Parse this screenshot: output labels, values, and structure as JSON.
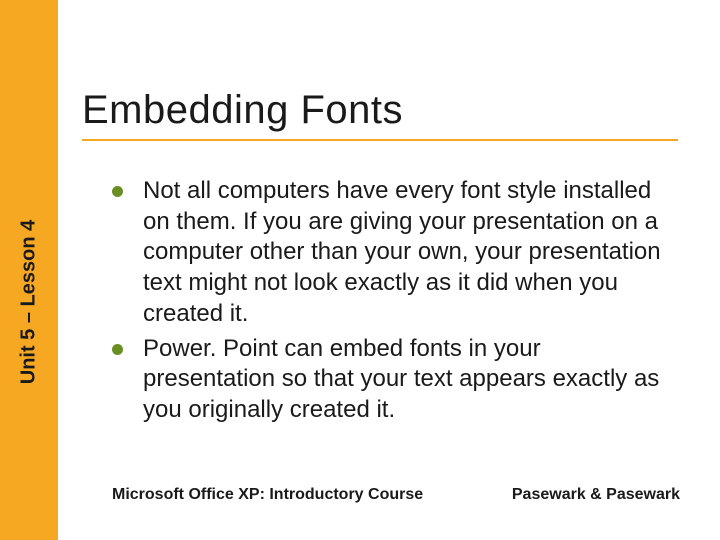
{
  "sidebar": {
    "label": "Unit 5 – Lesson 4"
  },
  "title": "Embedding Fonts",
  "bullets": [
    "Not all computers have every font style installed on them. If you are giving your presentation on a computer other than your own, your presentation text might not look exactly as it did when you created it.",
    "Power. Point can embed fonts in your presentation so that your text appears exactly as you originally created it."
  ],
  "footer": {
    "left": "Microsoft Office XP:  Introductory Course",
    "right": "Pasewark & Pasewark"
  }
}
